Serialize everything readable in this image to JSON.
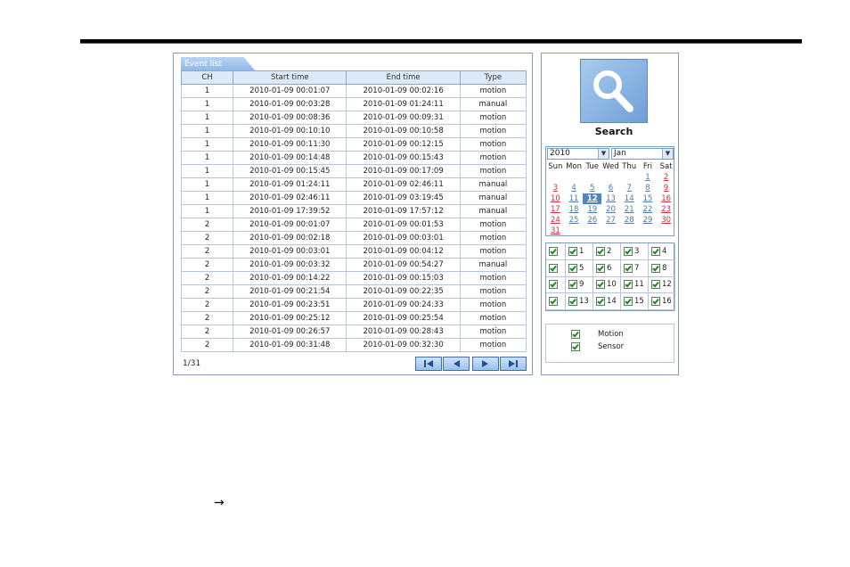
{
  "event_list": {
    "tab_label": "Event list",
    "columns": [
      "CH",
      "Start time",
      "End time",
      "Type"
    ],
    "rows": [
      [
        "1",
        "2010-01-09 00:01:07",
        "2010-01-09 00:02:16",
        "motion"
      ],
      [
        "1",
        "2010-01-09 00:03:28",
        "2010-01-09 01:24:11",
        "manual"
      ],
      [
        "1",
        "2010-01-09 00:08:36",
        "2010-01-09 00:09:31",
        "motion"
      ],
      [
        "1",
        "2010-01-09 00:10:10",
        "2010-01-09 00:10:58",
        "motion"
      ],
      [
        "1",
        "2010-01-09 00:11:30",
        "2010-01-09 00:12:15",
        "motion"
      ],
      [
        "1",
        "2010-01-09 00:14:48",
        "2010-01-09 00:15:43",
        "motion"
      ],
      [
        "1",
        "2010-01-09 00:15:45",
        "2010-01-09 00:17:09",
        "motion"
      ],
      [
        "1",
        "2010-01-09 01:24:11",
        "2010-01-09 02:46:11",
        "manual"
      ],
      [
        "1",
        "2010-01-09 02:46:11",
        "2010-01-09 03:19:45",
        "manual"
      ],
      [
        "1",
        "2010-01-09 17:39:52",
        "2010-01-09 17:57:12",
        "manual"
      ],
      [
        "2",
        "2010-01-09 00:01:07",
        "2010-01-09 00:01:53",
        "motion"
      ],
      [
        "2",
        "2010-01-09 00:02:18",
        "2010-01-09 00:03:01",
        "motion"
      ],
      [
        "2",
        "2010-01-09 00:03:01",
        "2010-01-09 00:04:12",
        "motion"
      ],
      [
        "2",
        "2010-01-09 00:03:32",
        "2010-01-09 00:54:27",
        "manual"
      ],
      [
        "2",
        "2010-01-09 00:14:22",
        "2010-01-09 00:15:03",
        "motion"
      ],
      [
        "2",
        "2010-01-09 00:21:54",
        "2010-01-09 00:22:35",
        "motion"
      ],
      [
        "2",
        "2010-01-09 00:23:51",
        "2010-01-09 00:24:33",
        "motion"
      ],
      [
        "2",
        "2010-01-09 00:25:12",
        "2010-01-09 00:25:54",
        "motion"
      ],
      [
        "2",
        "2010-01-09 00:26:57",
        "2010-01-09 00:28:43",
        "motion"
      ],
      [
        "2",
        "2010-01-09 00:31:48",
        "2010-01-09 00:32:30",
        "motion"
      ]
    ],
    "page_indicator": "1/31"
  },
  "search": {
    "label": "Search",
    "year": "2010",
    "month": "Jan",
    "weekdays": [
      "Sun",
      "Mon",
      "Tue",
      "Wed",
      "Thu",
      "Fri",
      "Sat"
    ],
    "first_weekday_index": 5,
    "days_in_month": 31,
    "selected_day": 12,
    "record_days": [
      1,
      2,
      3,
      4,
      5,
      6,
      7,
      8,
      9,
      10,
      11,
      12,
      13,
      14,
      15,
      16,
      17,
      18,
      19,
      20,
      21,
      22,
      23,
      24,
      25,
      26,
      27,
      28,
      29,
      30,
      31
    ],
    "channels": [
      "1",
      "2",
      "3",
      "4",
      "5",
      "6",
      "7",
      "8",
      "9",
      "10",
      "11",
      "12",
      "13",
      "14",
      "15",
      "16"
    ],
    "types": [
      "Motion",
      "Sensor"
    ]
  },
  "colors": {
    "accent": "#4f86c6",
    "weekend": "#d03030",
    "check": "#1e8a1e"
  },
  "footer_glyph": "→"
}
